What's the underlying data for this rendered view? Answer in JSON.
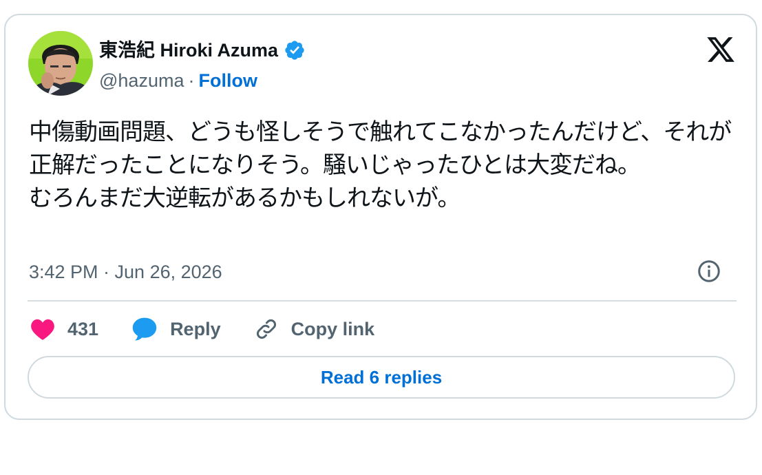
{
  "author": {
    "display_name": "東浩紀 Hiroki Azuma",
    "handle": "@hazuma",
    "separator": "·",
    "follow_label": "Follow",
    "verified": true
  },
  "tweet": {
    "text": "中傷動画問題、どうも怪しそうで触れてこなかったんだけど、それが正解だったことになりそう。騒いじゃったひとは大変だね。\nむろんまだ大逆転があるかもしれないが。",
    "timestamp": "3:42 PM · Jun 26, 2026"
  },
  "actions": {
    "like_count": "431",
    "reply_label": "Reply",
    "copy_link_label": "Copy link"
  },
  "footer": {
    "read_replies_label": "Read 6 replies"
  },
  "colors": {
    "accent": "#006fd6",
    "verified": "#1d9bf0",
    "like": "#f91880",
    "muted": "#536471",
    "border": "#cfd9de"
  },
  "icons": [
    "verified-badge-icon",
    "x-logo-icon",
    "info-icon",
    "heart-icon",
    "reply-bubble-icon",
    "link-icon"
  ]
}
